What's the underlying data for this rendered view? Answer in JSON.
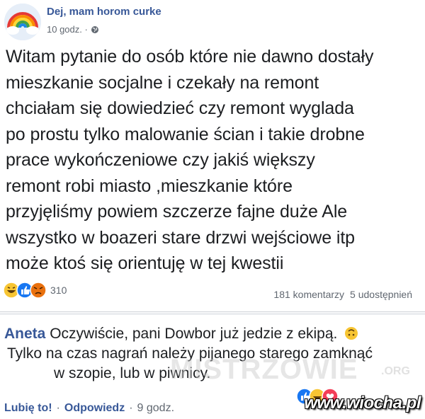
{
  "post": {
    "group_name": "Dej, mam horom curke",
    "time": "10 godz. ·",
    "avatar_icon": "rainbow-cloud-icon",
    "audience_icon": "globe-icon",
    "text": "Witam pytanie do osób które nie dawno dostały\nmieszkanie socjalne i czekały na remont\nchciałam się dowiedzieć czy remont wyglada\npo prostu tylko malowanie ścian i takie drobne\nprace wykończeniowe czy jakiś większy\nremont robi miasto ,mieszkanie które\nprzyjęliśmy powiem szczerze fajne duże Ale\nwszystko w boazeri stare drzwi wejściowe itp\nmoże ktoś się orientuję w tej kwestii",
    "reaction_count": "310",
    "comments": "181 komentarzy",
    "shares": "5 udostępnień",
    "reaction_icons": [
      "haha-icon",
      "like-icon",
      "angry-icon"
    ]
  },
  "comment": {
    "author": "Aneta",
    "line1": "Oczywiście, pani Dowbor już jedzie z ekipą.",
    "emoji_icon": "upside-down-face-icon",
    "line2": "Tylko na czas nagrań należy pijanego starego zamknąć",
    "line3": "w szopie, lub w piwnicy.",
    "like_label": "Lubię to!",
    "reply_label": "Odpowiedz",
    "time": "9 godz.",
    "reaction_icons": [
      "like-icon",
      "haha-icon",
      "love-icon"
    ]
  },
  "watermarks": {
    "main": "MISTRZOWIE",
    "domain": ".ORG",
    "site": "www.wiocha.pl"
  },
  "colors": {
    "link": "#385898",
    "secondary_text": "#606770",
    "like_blue": "#1877f2",
    "haha_yellow": "#f7c533",
    "angry_orange": "#e9710f",
    "love_red": "#f33e58"
  }
}
